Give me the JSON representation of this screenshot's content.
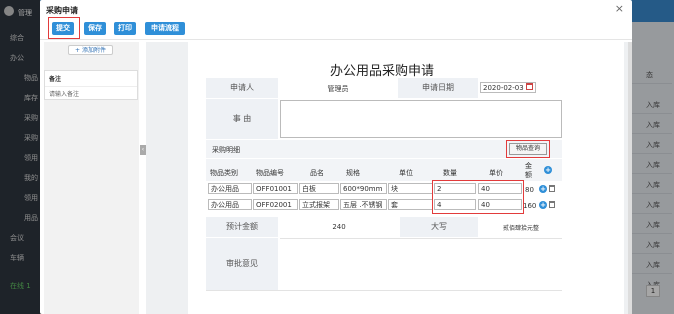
{
  "background": {
    "top_left_label": "管理",
    "sidebar_items": [
      "综合",
      "办公",
      "物品",
      "库存",
      "采购",
      "采购",
      "领用",
      "我的",
      "领用",
      "用品",
      "会议",
      "车辆"
    ],
    "status": "在线 1",
    "right_items": [
      "态",
      "入库",
      "入库",
      "入库",
      "入库",
      "入库",
      "入库",
      "入库",
      "入库",
      "入库",
      "入库"
    ],
    "page_num": "1"
  },
  "modal": {
    "title": "采购申请",
    "close": "×",
    "buttons": {
      "submit": "提交",
      "save": "保存",
      "print": "打印",
      "flow": "申请流程"
    },
    "attach": "+ 添加附件",
    "remark_label": "备注",
    "remark_placeholder": "请输入备注"
  },
  "form": {
    "title": "办公用品采购申请",
    "applicant_label": "申请人",
    "applicant": "管理员",
    "date_label": "申请日期",
    "date": "2020-02-03",
    "reason_label": "事    由",
    "detail_label": "采购明细",
    "query_button": "物品查询",
    "headers": [
      "物品类别",
      "物品编号",
      "品名",
      "规格",
      "单位",
      "数量",
      "单价",
      "金额"
    ],
    "rows": [
      {
        "category": "办公用品",
        "code": "OFF01001",
        "name": "白板",
        "spec": "600*90mm",
        "unit": "块",
        "qty": "2",
        "price": "40",
        "amount": "80"
      },
      {
        "category": "办公用品",
        "code": "OFF02001",
        "name": "立式报架",
        "spec": "五层 .不锈钢",
        "unit": "套",
        "qty": "4",
        "price": "40",
        "amount": "160"
      }
    ],
    "total_label": "预计金额",
    "total": "240",
    "upper_label": "大写",
    "upper": "贰佰肆拾元整",
    "approval_label": "审批意见"
  },
  "colors": {
    "primary": "#2f8fd8",
    "highlight": "#e23b3b"
  }
}
